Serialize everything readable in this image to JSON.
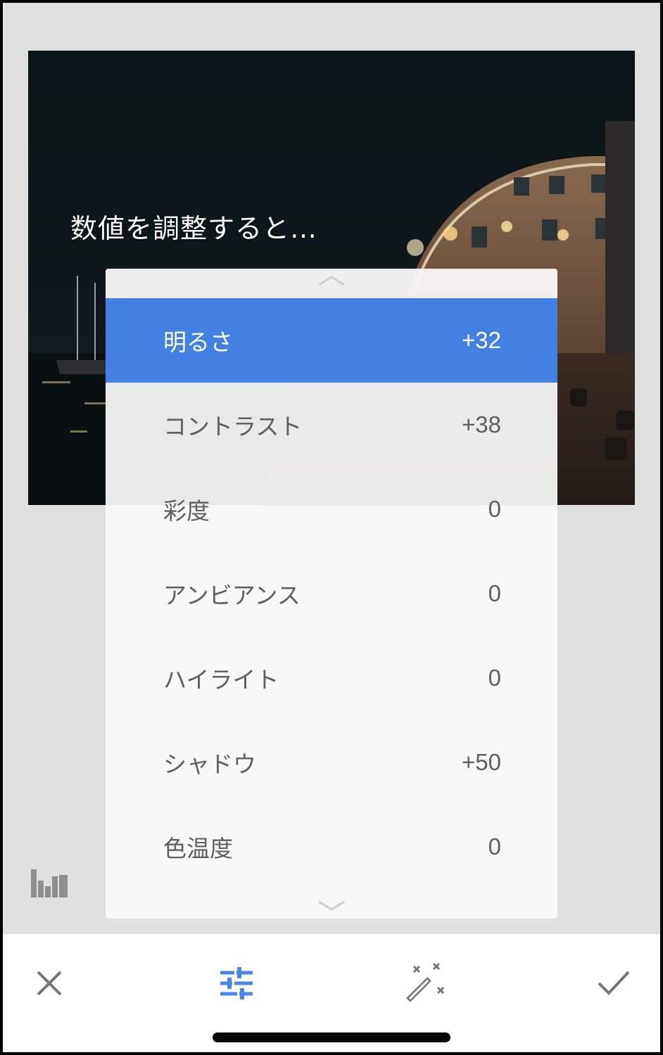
{
  "overlay": {
    "caption": "数値を調整すると…"
  },
  "adjustments": [
    {
      "label": "明るさ",
      "value": "+32",
      "selected": true
    },
    {
      "label": "コントラスト",
      "value": "+38",
      "selected": false
    },
    {
      "label": "彩度",
      "value": "0",
      "selected": false
    },
    {
      "label": "アンビアンス",
      "value": "0",
      "selected": false
    },
    {
      "label": "ハイライト",
      "value": "0",
      "selected": false
    },
    {
      "label": "シャドウ",
      "value": "+50",
      "selected": false
    },
    {
      "label": "色温度",
      "value": "0",
      "selected": false
    }
  ],
  "icons": {
    "scroll_up": "chevron-up-icon",
    "scroll_down": "chevron-down-icon",
    "histogram": "histogram-icon",
    "cancel": "close-icon",
    "adjust": "sliders-icon",
    "auto": "magic-wand-icon",
    "apply": "checkmark-icon"
  },
  "colors": {
    "selected_row": "#4480e2",
    "accent_icon": "#4a86e8",
    "toolbar_icon": "#757575",
    "background": "#e0e0e0"
  }
}
